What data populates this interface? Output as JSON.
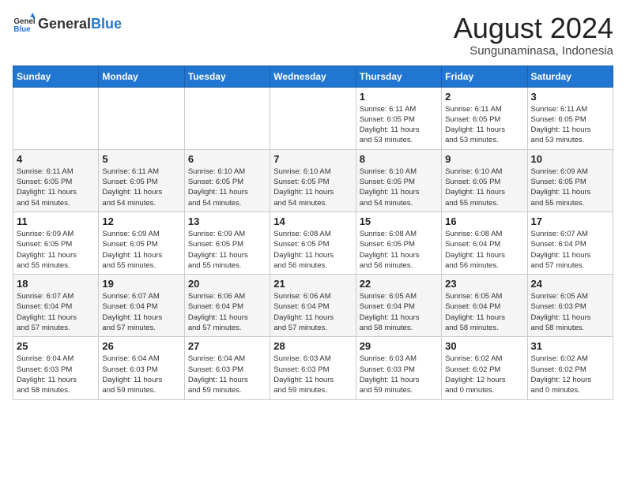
{
  "header": {
    "logo_general": "General",
    "logo_blue": "Blue",
    "month_year": "August 2024",
    "location": "Sungunaminasa, Indonesia"
  },
  "days_of_week": [
    "Sunday",
    "Monday",
    "Tuesday",
    "Wednesday",
    "Thursday",
    "Friday",
    "Saturday"
  ],
  "weeks": [
    [
      {
        "day": "",
        "info": ""
      },
      {
        "day": "",
        "info": ""
      },
      {
        "day": "",
        "info": ""
      },
      {
        "day": "",
        "info": ""
      },
      {
        "day": "1",
        "info": "Sunrise: 6:11 AM\nSunset: 6:05 PM\nDaylight: 11 hours\nand 53 minutes."
      },
      {
        "day": "2",
        "info": "Sunrise: 6:11 AM\nSunset: 6:05 PM\nDaylight: 11 hours\nand 53 minutes."
      },
      {
        "day": "3",
        "info": "Sunrise: 6:11 AM\nSunset: 6:05 PM\nDaylight: 11 hours\nand 53 minutes."
      }
    ],
    [
      {
        "day": "4",
        "info": "Sunrise: 6:11 AM\nSunset: 6:05 PM\nDaylight: 11 hours\nand 54 minutes."
      },
      {
        "day": "5",
        "info": "Sunrise: 6:11 AM\nSunset: 6:05 PM\nDaylight: 11 hours\nand 54 minutes."
      },
      {
        "day": "6",
        "info": "Sunrise: 6:10 AM\nSunset: 6:05 PM\nDaylight: 11 hours\nand 54 minutes."
      },
      {
        "day": "7",
        "info": "Sunrise: 6:10 AM\nSunset: 6:05 PM\nDaylight: 11 hours\nand 54 minutes."
      },
      {
        "day": "8",
        "info": "Sunrise: 6:10 AM\nSunset: 6:05 PM\nDaylight: 11 hours\nand 54 minutes."
      },
      {
        "day": "9",
        "info": "Sunrise: 6:10 AM\nSunset: 6:05 PM\nDaylight: 11 hours\nand 55 minutes."
      },
      {
        "day": "10",
        "info": "Sunrise: 6:09 AM\nSunset: 6:05 PM\nDaylight: 11 hours\nand 55 minutes."
      }
    ],
    [
      {
        "day": "11",
        "info": "Sunrise: 6:09 AM\nSunset: 6:05 PM\nDaylight: 11 hours\nand 55 minutes."
      },
      {
        "day": "12",
        "info": "Sunrise: 6:09 AM\nSunset: 6:05 PM\nDaylight: 11 hours\nand 55 minutes."
      },
      {
        "day": "13",
        "info": "Sunrise: 6:09 AM\nSunset: 6:05 PM\nDaylight: 11 hours\nand 55 minutes."
      },
      {
        "day": "14",
        "info": "Sunrise: 6:08 AM\nSunset: 6:05 PM\nDaylight: 11 hours\nand 56 minutes."
      },
      {
        "day": "15",
        "info": "Sunrise: 6:08 AM\nSunset: 6:05 PM\nDaylight: 11 hours\nand 56 minutes."
      },
      {
        "day": "16",
        "info": "Sunrise: 6:08 AM\nSunset: 6:04 PM\nDaylight: 11 hours\nand 56 minutes."
      },
      {
        "day": "17",
        "info": "Sunrise: 6:07 AM\nSunset: 6:04 PM\nDaylight: 11 hours\nand 57 minutes."
      }
    ],
    [
      {
        "day": "18",
        "info": "Sunrise: 6:07 AM\nSunset: 6:04 PM\nDaylight: 11 hours\nand 57 minutes."
      },
      {
        "day": "19",
        "info": "Sunrise: 6:07 AM\nSunset: 6:04 PM\nDaylight: 11 hours\nand 57 minutes."
      },
      {
        "day": "20",
        "info": "Sunrise: 6:06 AM\nSunset: 6:04 PM\nDaylight: 11 hours\nand 57 minutes."
      },
      {
        "day": "21",
        "info": "Sunrise: 6:06 AM\nSunset: 6:04 PM\nDaylight: 11 hours\nand 57 minutes."
      },
      {
        "day": "22",
        "info": "Sunrise: 6:05 AM\nSunset: 6:04 PM\nDaylight: 11 hours\nand 58 minutes."
      },
      {
        "day": "23",
        "info": "Sunrise: 6:05 AM\nSunset: 6:04 PM\nDaylight: 11 hours\nand 58 minutes."
      },
      {
        "day": "24",
        "info": "Sunrise: 6:05 AM\nSunset: 6:03 PM\nDaylight: 11 hours\nand 58 minutes."
      }
    ],
    [
      {
        "day": "25",
        "info": "Sunrise: 6:04 AM\nSunset: 6:03 PM\nDaylight: 11 hours\nand 58 minutes."
      },
      {
        "day": "26",
        "info": "Sunrise: 6:04 AM\nSunset: 6:03 PM\nDaylight: 11 hours\nand 59 minutes."
      },
      {
        "day": "27",
        "info": "Sunrise: 6:04 AM\nSunset: 6:03 PM\nDaylight: 11 hours\nand 59 minutes."
      },
      {
        "day": "28",
        "info": "Sunrise: 6:03 AM\nSunset: 6:03 PM\nDaylight: 11 hours\nand 59 minutes."
      },
      {
        "day": "29",
        "info": "Sunrise: 6:03 AM\nSunset: 6:03 PM\nDaylight: 11 hours\nand 59 minutes."
      },
      {
        "day": "30",
        "info": "Sunrise: 6:02 AM\nSunset: 6:02 PM\nDaylight: 12 hours\nand 0 minutes."
      },
      {
        "day": "31",
        "info": "Sunrise: 6:02 AM\nSunset: 6:02 PM\nDaylight: 12 hours\nand 0 minutes."
      }
    ]
  ]
}
